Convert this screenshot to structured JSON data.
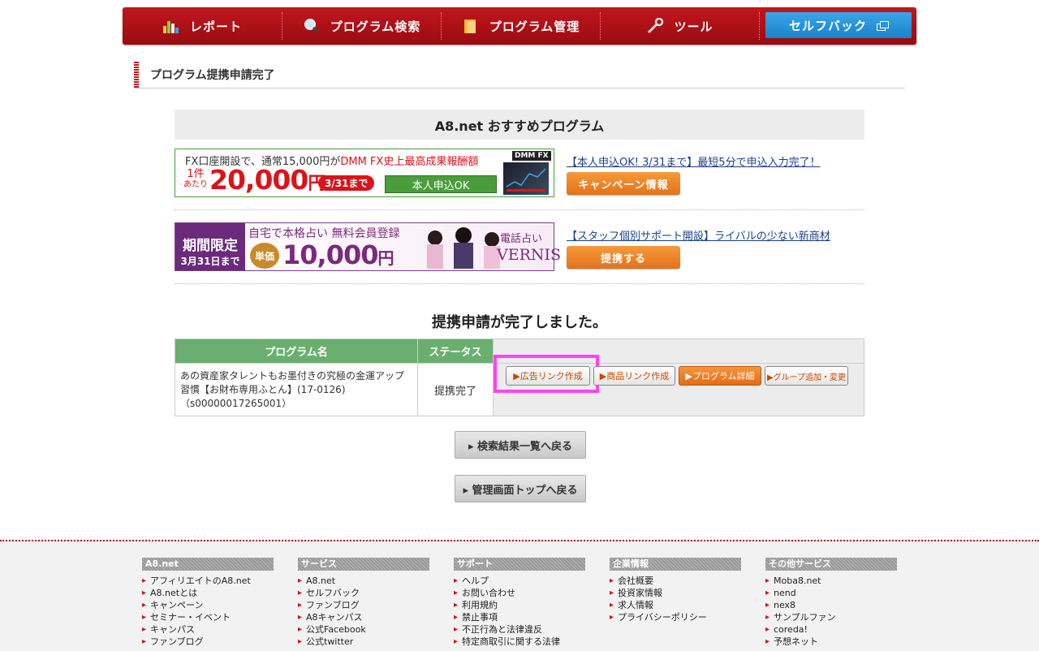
{
  "nav": {
    "items": [
      {
        "label": "レポート",
        "icon": "bar-chart-icon"
      },
      {
        "label": "プログラム検索",
        "icon": "magnifier-icon"
      },
      {
        "label": "プログラム管理",
        "icon": "folder-icon"
      },
      {
        "label": "ツール",
        "icon": "wrench-icon"
      }
    ],
    "self_back": "セルフバック"
  },
  "heading": "プログラム提携申請完了",
  "recommend_title": "A8.net おすすめプログラム",
  "promo1": {
    "banner_line1_a": "FX口座開設で、通常15,000円が",
    "banner_line1_b": "DMM FX史上最高成果報酬額",
    "banner_brand": "DMM FX",
    "banner_unit_a": "1件",
    "banner_unit_b": "あたり",
    "banner_amount": "20,000",
    "banner_yen": "円",
    "banner_date": "3/31まで",
    "banner_ok": "本人申込OK",
    "link": "【本人申込OK! 3/31まで】最短5分で申込入力完了！",
    "button": "キャンペーン情報"
  },
  "promo2": {
    "banner_limit_a": "期間限定",
    "banner_limit_b": "3月31日まで",
    "banner_text": "自宅で本格占い 無料会員登録",
    "banner_unit": "単価",
    "banner_amount": "10,000",
    "banner_yen": "円",
    "banner_brand_a": "電話占い",
    "banner_brand_b": "VERNIS",
    "link": "【スタッフ個別サポート開設】ライバルの少ない新商材",
    "button": "提携する"
  },
  "done_message": "提携申請が完了しました。",
  "table": {
    "headers": [
      "プログラム名",
      "ステータス",
      ""
    ],
    "program_name": "あの資産家タレントもお墨付きの究極の金運アップ習慣【お財布専用ふとん】(17-0126)（s00000017265001）",
    "status": "提携完了",
    "buttons": [
      "▶広告リンク作成",
      "▶商品リンク作成",
      "▶プログラム詳細",
      "▶グループ追加・変更"
    ]
  },
  "back_search": "▸ 検索結果一覧へ戻る",
  "back_top": "▸ 管理画面トップへ戻る",
  "footer": [
    {
      "title": "A8.net",
      "items": [
        "アフィリエイトのA8.net",
        "A8.netとは",
        "キャンペーン",
        "セミナー・イベント",
        "キャンパス",
        "ファンブログ"
      ]
    },
    {
      "title": "サービス",
      "items": [
        "A8.net",
        "セルフバック",
        "ファンブログ",
        "A8キャンパス",
        "公式Facebook",
        "公式twitter"
      ]
    },
    {
      "title": "サポート",
      "items": [
        "ヘルプ",
        "お問い合わせ",
        "利用規約",
        "禁止事項",
        "不正行為と法律違反",
        "特定商取引に関する法律"
      ]
    },
    {
      "title": "企業情報",
      "items": [
        "会社概要",
        "投資家情報",
        "求人情報",
        "プライバシーポリシー"
      ]
    },
    {
      "title": "その他サービス",
      "items": [
        "Moba8.net",
        "nend",
        "nex8",
        "サンプルファン",
        "coreda!",
        "予想ネット"
      ]
    }
  ],
  "colors": {
    "brand_red": "#c0161d",
    "accent_orange": "#e4721a",
    "table_green": "#6aaf6f",
    "highlight": "#ff44ee"
  }
}
